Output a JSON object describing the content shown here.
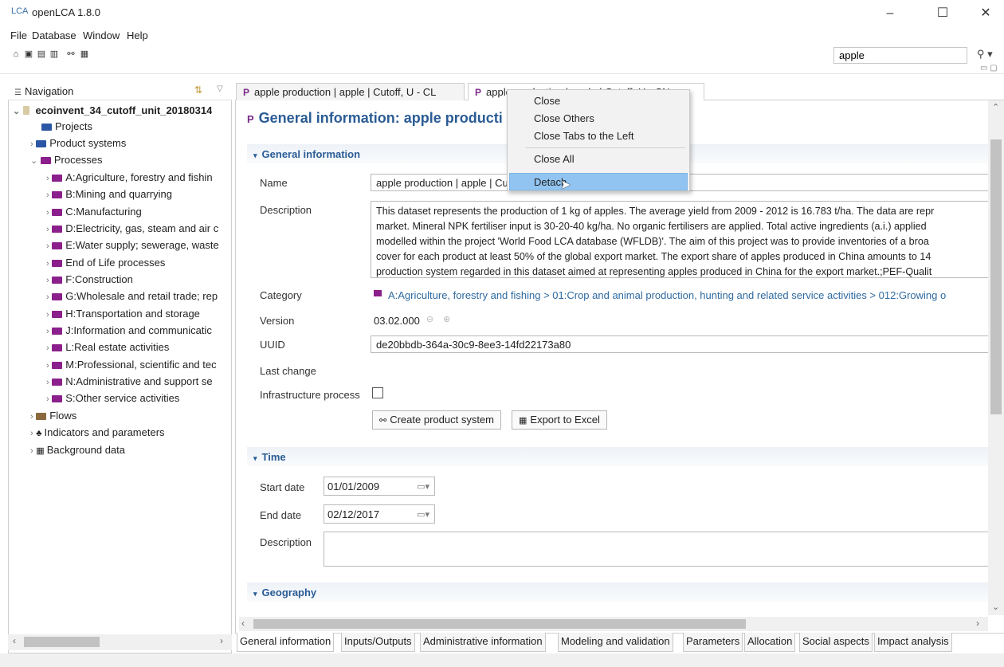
{
  "window": {
    "logo_text": "LCA",
    "title": "openLCA 1.8.0",
    "minimize_label": "–",
    "maximize_label": "☐",
    "close_label": "✕"
  },
  "menu": [
    "File",
    "Database",
    "Window",
    "Help"
  ],
  "toolbar": {
    "search_value": "apple"
  },
  "navigation": {
    "title": "Navigation",
    "root": "ecoinvent_34_cutoff_unit_20180314",
    "items": [
      {
        "label": "Projects"
      },
      {
        "label": "Product systems"
      },
      {
        "label": "Processes"
      },
      {
        "label": "A:Agriculture, forestry and fishin"
      },
      {
        "label": "B:Mining and quarrying"
      },
      {
        "label": "C:Manufacturing"
      },
      {
        "label": "D:Electricity, gas, steam and air c"
      },
      {
        "label": "E:Water supply; sewerage, waste"
      },
      {
        "label": "End of Life processes"
      },
      {
        "label": "F:Construction"
      },
      {
        "label": "G:Wholesale and retail trade; rep"
      },
      {
        "label": "H:Transportation and storage"
      },
      {
        "label": "J:Information and communicatic"
      },
      {
        "label": "L:Real estate activities"
      },
      {
        "label": "M:Professional, scientific and tec"
      },
      {
        "label": "N:Administrative and support se"
      },
      {
        "label": "S:Other service activities"
      },
      {
        "label": "Flows"
      },
      {
        "label": "Indicators and parameters"
      },
      {
        "label": "Background data"
      }
    ]
  },
  "editor_tabs": [
    {
      "label": "apple production | apple | Cutoff, U - CL"
    },
    {
      "label": "apple production | apple | Cutoff, U - CN"
    }
  ],
  "editor": {
    "title": "General information: apple producti",
    "section_general": "General information",
    "name_label": "Name",
    "name_value": "apple production | apple | Cutoff, U - CN",
    "description_label": "Description",
    "description_lines": [
      "This dataset represents the production of 1 kg of apples. The average yield from 2009 - 2012 is 16.783 t/ha. The data are repr",
      "market. Mineral NPK fertiliser input is 30-20-40 kg/ha. No organic fertilisers are applied. Total active ingredients (a.i.) applied",
      "modelled within the project 'World Food LCA database (WFLDB)'. The aim of this project was to provide inventories of a broa",
      "cover for each product at least 50% of the global export market. The export share of apples produced in China amounts to 14",
      "production system regarded in this dataset aimed at representing apples produced in China for the export market.;PEF-Qualit"
    ],
    "category_label": "Category",
    "category_value": "A:Agriculture, forestry and fishing > 01:Crop and animal production, hunting and related service activities > 012:Growing o",
    "version_label": "Version",
    "version_value": "03.02.000",
    "uuid_label": "UUID",
    "uuid_value": "de20bbdb-364a-30c9-8ee3-14fd22173a80",
    "last_change_label": "Last change",
    "infrastructure_label": "Infrastructure process",
    "create_product_system_label": "Create product system",
    "export_excel_label": "Export to Excel",
    "section_time": "Time",
    "start_date_label": "Start date",
    "start_date_value": "01/01/2009",
    "end_date_label": "End date",
    "end_date_value": "02/12/2017",
    "time_description_label": "Description",
    "section_geography": "Geography"
  },
  "bottom_tabs": [
    "General information",
    "Inputs/Outputs",
    "Administrative information",
    "Modeling and validation",
    "Parameters",
    "Allocation",
    "Social aspects",
    "Impact analysis"
  ],
  "context_menu": {
    "items": [
      "Close",
      "Close Others",
      "Close Tabs to the Left",
      "Close All",
      "Detach"
    ],
    "highlighted": "Detach"
  }
}
